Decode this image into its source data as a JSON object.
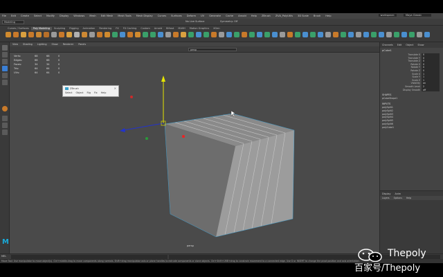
{
  "menubar": {
    "items": [
      "File",
      "Edit",
      "Create",
      "Select",
      "Modify",
      "Display",
      "Windows",
      "Mesh",
      "Edit Mesh",
      "Mesh Tools",
      "Mesh Display",
      "Curves",
      "Surfaces",
      "Deform",
      "UV",
      "Generate",
      "Cache",
      "Arnold",
      "Help",
      "ZBrush",
      "ZiVA_PolyUtils",
      "3D Scale",
      "Brush",
      "Help"
    ],
    "workspace": "workspace:",
    "workspace_value": "Maya Classic"
  },
  "statusline": {
    "mode": "Modeling",
    "symmetry": "No Live Surface",
    "live": "Symmetry: Off"
  },
  "shelf": {
    "tabs": [
      "Curves / Surfaces",
      "Poly Modeling",
      "Sculpting",
      "Rigging",
      "Animation",
      "Rendering",
      "FX",
      "FX Caching",
      "Custom",
      "Arnold",
      "Bifrost",
      "MASH",
      "Motion Graphics",
      "XGen"
    ],
    "active_tab": "Poly Modeling"
  },
  "viewport": {
    "menu": [
      "View",
      "Shading",
      "Lighting",
      "Show",
      "Renderer",
      "Panels"
    ],
    "camera": "persp",
    "camera_label": "persp",
    "stats": [
      {
        "label": "Verts:",
        "a": "68",
        "b": "68",
        "c": "0"
      },
      {
        "label": "Edges:",
        "a": "68",
        "b": "68",
        "c": "0"
      },
      {
        "label": "Faces:",
        "a": "34",
        "b": "34",
        "c": "0"
      },
      {
        "label": "Tris:",
        "a": "64",
        "b": "64",
        "c": "0"
      },
      {
        "label": "UVs:",
        "a": "64",
        "b": "64",
        "c": "0"
      }
    ]
  },
  "popup": {
    "title": "ZBrush",
    "menu": [
      "Select",
      "Object",
      "Rig",
      "Fix",
      "Help"
    ]
  },
  "channelbox": {
    "tabs": [
      "Channels",
      "Edit",
      "Object",
      "Show"
    ],
    "object": "pCube1",
    "attributes": [
      {
        "name": "Translate X",
        "value": "0"
      },
      {
        "name": "Translate Y",
        "value": "0"
      },
      {
        "name": "Translate Z",
        "value": "0"
      },
      {
        "name": "Rotate X",
        "value": "0"
      },
      {
        "name": "Rotate Y",
        "value": "0"
      },
      {
        "name": "Rotate Z",
        "value": "0"
      },
      {
        "name": "Scale X",
        "value": "1"
      },
      {
        "name": "Scale Y",
        "value": "1"
      },
      {
        "name": "Scale Z",
        "value": "1"
      },
      {
        "name": "Visibility",
        "value": "on"
      },
      {
        "name": "Smooth Level",
        "value": "2"
      },
      {
        "name": "Display Smooth",
        "value": "off"
      }
    ],
    "shapes_header": "SHAPES",
    "shapes": [
      "pCubeShape1"
    ],
    "inputs_header": "INPUTS",
    "inputs": [
      "polySplit1",
      "polySplit2",
      "polySplit3",
      "polySplit4",
      "polySplit5",
      "polySplit6",
      "polyCube1"
    ]
  },
  "layers": {
    "tabs": [
      "Display",
      "Anim"
    ],
    "menu": [
      "Layers",
      "Options",
      "Help"
    ]
  },
  "cmdline": {
    "mel": "MEL"
  },
  "helpline": "Move Tool: Use manipulator to move object(s). Ctrl+middle-drag to move components along normals. Shift+drag manipulator axis or plane handles to extrude components or clone objects. Ctrl+Shift+LMB+drag to constrain movement to a connected edge. Use D or INSERT to change the pivot position and axis orientation.",
  "watermark": {
    "en": "Thepoly",
    "cn": "百家号/Thepoly"
  }
}
